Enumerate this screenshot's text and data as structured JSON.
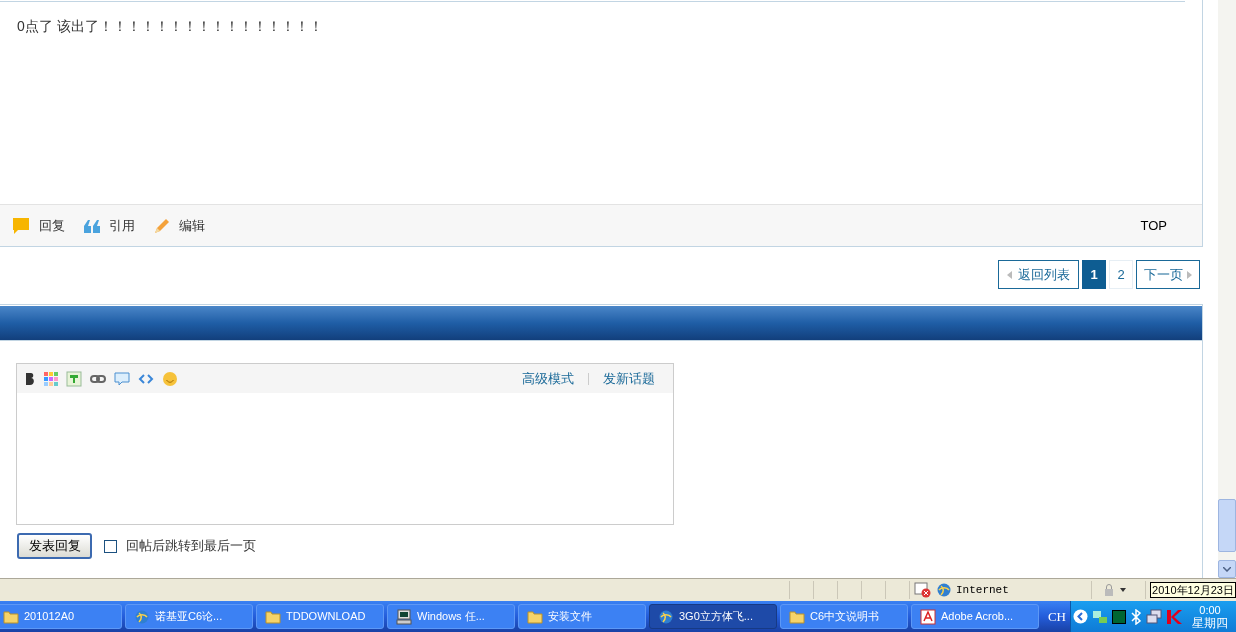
{
  "post": {
    "text": "0点了 该出了！！！！！！！！！！！！！！！！",
    "actions": [
      {
        "kind": "reply",
        "label": "回复"
      },
      {
        "kind": "quote",
        "label": "引用"
      },
      {
        "kind": "edit",
        "label": "编辑"
      }
    ],
    "top_link": "TOP"
  },
  "pagination": {
    "back": "返回列表",
    "pages": [
      {
        "label": "1",
        "selected": true
      },
      {
        "label": "2",
        "selected": false
      }
    ],
    "next": "下一页"
  },
  "editor": {
    "tools": [
      {
        "kind": "bold"
      },
      {
        "kind": "color"
      },
      {
        "kind": "image"
      },
      {
        "kind": "link"
      },
      {
        "kind": "quote"
      },
      {
        "kind": "code"
      },
      {
        "kind": "smiley"
      }
    ],
    "links": [
      "高级模式",
      "发新话题"
    ],
    "submit": "发表回复",
    "jump_checkbox": {
      "label": "回帖后跳转到最后一页",
      "checked": false
    }
  },
  "status_bar": {
    "zone": "Internet",
    "tooltip": "2010年12月23日"
  },
  "taskbar": {
    "items": [
      {
        "kind": "folder",
        "label": "201012A0",
        "selected": false
      },
      {
        "kind": "browser",
        "label": "诺基亚C6论...",
        "selected": false
      },
      {
        "kind": "folder",
        "label": "TDDOWNLOAD",
        "selected": false
      },
      {
        "kind": "computer",
        "label": "Windows 任...",
        "selected": false
      },
      {
        "kind": "folder",
        "label": "安装文件",
        "selected": false
      },
      {
        "kind": "browser",
        "label": "3G0立方体飞...",
        "selected": true
      },
      {
        "kind": "folder",
        "label": "C6中文说明书",
        "selected": false
      },
      {
        "kind": "pdf",
        "label": "Adobe Acrob...",
        "selected": false
      }
    ],
    "language": "CH",
    "time": "0:00",
    "day": "星期四"
  }
}
